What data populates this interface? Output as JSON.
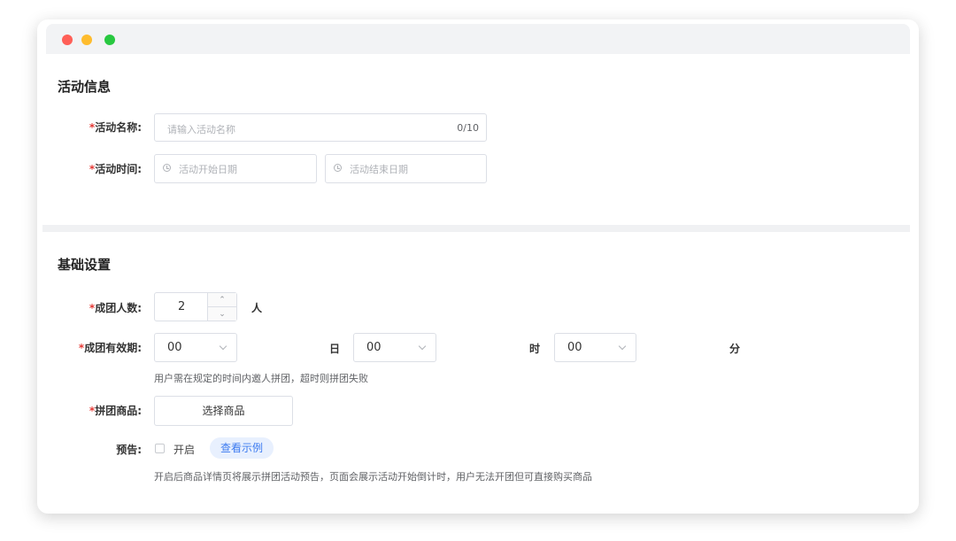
{
  "activity_info": {
    "title": "活动信息",
    "name_label": "活动名称:",
    "name_placeholder": "请输入活动名称",
    "name_counter": "0/10",
    "time_label": "活动时间:",
    "start_placeholder": "活动开始日期",
    "end_placeholder": "活动结束日期"
  },
  "basic_settings": {
    "title": "基础设置",
    "group_size_label": "成团人数:",
    "group_size_value": "2",
    "group_size_unit": "人",
    "validity_label": "成团有效期:",
    "validity_day_value": "00",
    "validity_day_unit": "日",
    "validity_hour_value": "00",
    "validity_hour_unit": "时",
    "validity_minute_value": "00",
    "validity_minute_unit": "分",
    "validity_hint": "用户需在规定的时间内邀人拼团，超时则拼团失败",
    "product_label": "拼团商品:",
    "select_product_button": "选择商品",
    "preview_label": "预告:",
    "preview_checkbox_label": "开启",
    "view_example_button": "查看示例",
    "preview_hint": "开启后商品详情页将展示拼团活动预告，页面会展示活动开始倒计时，用户无法开团但可直接购买商品"
  },
  "required_mark": "*",
  "colors": {
    "required": "#e53935",
    "accent": "#3d7bf0",
    "border": "#dcdfe6"
  }
}
